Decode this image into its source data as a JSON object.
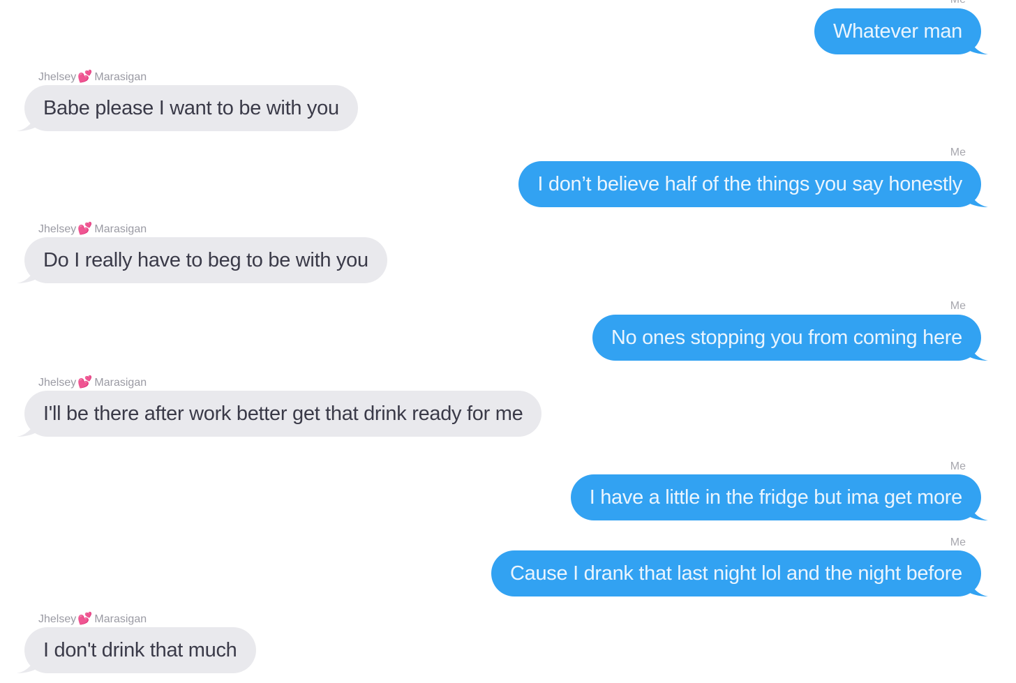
{
  "conversation": {
    "contact_first": "Jhelsey",
    "contact_last": "Marasigan",
    "contact_emoji": "💕",
    "me_label": "Me",
    "colors": {
      "outgoing_bubble": "#32a2f2",
      "incoming_bubble": "#e9e9ed",
      "heart": "#e84aa8"
    },
    "messages": [
      {
        "from": "me",
        "text": "Whatever man"
      },
      {
        "from": "contact",
        "text": "Babe please I want to be with you"
      },
      {
        "from": "me",
        "text": "I don’t believe half of the things you say honestly"
      },
      {
        "from": "contact",
        "text": "Do I really have to beg to be with you"
      },
      {
        "from": "me",
        "text": "No ones stopping you from coming here"
      },
      {
        "from": "contact",
        "text": "I'll be there after work better get that drink ready for me"
      },
      {
        "from": "me",
        "text": "I have a little in the fridge but ima get more"
      },
      {
        "from": "me",
        "text": "Cause I drank that last night lol and the night before"
      },
      {
        "from": "contact",
        "text": "I don't drink that much"
      }
    ]
  }
}
